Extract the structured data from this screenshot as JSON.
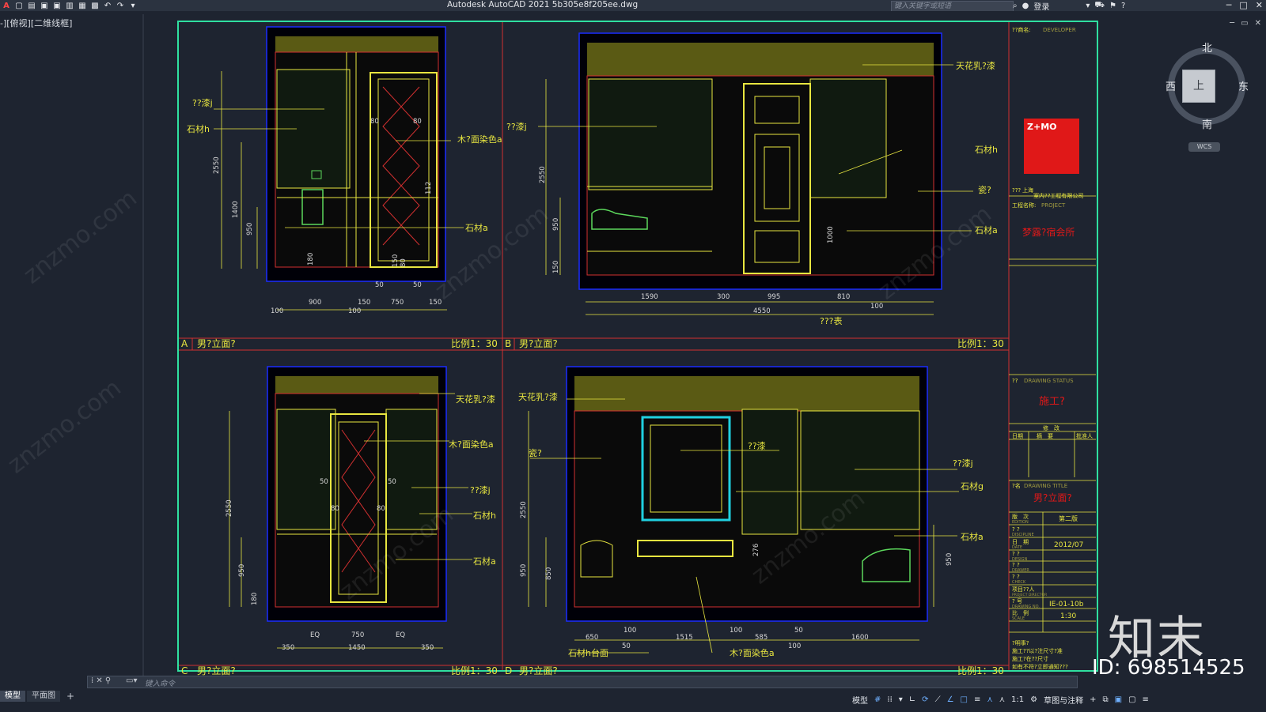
{
  "app": {
    "title": "Autodesk AutoCAD 2021    5b305e8f205ee.dwg",
    "search_placeholder": "键入关键字或短语",
    "login_label": "登录"
  },
  "viewport": {
    "label": "-][俯视][二维线框]"
  },
  "viewcube": {
    "north": "北",
    "south": "南",
    "east": "东",
    "west": "西",
    "face": "上",
    "wcs": "WCS"
  },
  "drawing": {
    "panels": {
      "a": {
        "letter": "A",
        "title": "男?立面?",
        "scale": "比例1：30"
      },
      "b": {
        "letter": "B",
        "title": "男?立面?",
        "scale": "比例1：30"
      },
      "c": {
        "letter": "C",
        "title": "男?立面?",
        "scale": "比例1：30"
      },
      "d": {
        "letter": "D",
        "title": "男?立面?",
        "scale": "比例1：30"
      }
    },
    "labels_a": [
      "??漆j",
      "石材h",
      "木?面染色a",
      "石材a"
    ],
    "dims_a": [
      "2550",
      "1400",
      "950",
      "180",
      "80",
      "80",
      "112",
      "150",
      "80",
      "50",
      "50",
      "100",
      "900",
      "100",
      "150",
      "750",
      "150"
    ],
    "labels_b": [
      "天花乳?漆",
      "??漆j",
      "石材h",
      "瓷?",
      "石材a",
      "???表"
    ],
    "dims_b": [
      "2550",
      "950",
      "150",
      "1000",
      "1590",
      "300",
      "995",
      "810",
      "100",
      "4550"
    ],
    "labels_c": [
      "天花乳?漆",
      "木?面染色a",
      "??漆j",
      "石材h",
      "石材a"
    ],
    "dims_c": [
      "2550",
      "950",
      "180",
      "50",
      "50",
      "80",
      "80",
      "EQ",
      "750",
      "EQ",
      "350",
      "1450",
      "350"
    ],
    "labels_d": [
      "天花乳?漆",
      "瓷?",
      "??漆",
      "??漆j",
      "石材g",
      "石材a",
      "石材h台面",
      "木?面染色a"
    ],
    "dims_d": [
      "2550",
      "950",
      "850",
      "276",
      "950",
      "650",
      "100",
      "50",
      "1515",
      "100",
      "585",
      "50",
      "1600",
      "100"
    ]
  },
  "title_block": {
    "designer_label": "??商名:",
    "designer_en": "DEVELOPER",
    "company_label": "???",
    "company_name": "上海",
    "company_name2": "室内??工程有限公司",
    "project_label": "工程名称:",
    "project_en": "PROJECT",
    "project_name": "梦露?宿会所",
    "status_label": "??",
    "status_en": "DRAWING STATUS",
    "status_value": "施工?",
    "revision_header": "修　改",
    "rev_cols": [
      "日期",
      "摘　要",
      "批准人"
    ],
    "title_label": "?名",
    "title_en": "DRAWING TITLE",
    "title_value": "男?立面?",
    "rows": [
      {
        "label": "版　次",
        "en": "EDITION",
        "value": "第二版"
      },
      {
        "label": "? ?",
        "en": "DISCIPLINE",
        "value": ""
      },
      {
        "label": "日　期",
        "en": "DATE",
        "value": "2012/07"
      },
      {
        "label": "? ?",
        "en": "DESIGN",
        "value": ""
      },
      {
        "label": "? ?",
        "en": "DRAWER",
        "value": ""
      },
      {
        "label": "? ?",
        "en": "CHECK",
        "value": ""
      },
      {
        "label": "项目??人",
        "en": "PROJECT DIRECTOR",
        "value": ""
      },
      {
        "label": "? 号",
        "en": "DRAWING NO.",
        "value": "IE-01-10b"
      },
      {
        "label": "比　例",
        "en": "SCALE",
        "value": "1:30"
      }
    ],
    "notes_label": "?明事?",
    "notes": [
      "施工??以?注尺寸?准",
      "施工?在??尺寸",
      "如有不符?立即通知???"
    ],
    "logo_text": "Z+MO"
  },
  "watermark": {
    "site": "znzmo.com",
    "brand": "知末",
    "id": "ID: 698514525"
  },
  "command": {
    "placeholder": "键入命令"
  },
  "tabs": [
    "模型",
    "平面图"
  ],
  "status": {
    "model": "模型",
    "scale": "1:1",
    "workspace": "草图与注释"
  },
  "colors": {
    "background": "#1e2430",
    "frame": "#2fe0a0",
    "panel_border": "#d23030",
    "yellow": "#e8e640",
    "green": "#5cd85c",
    "dim_white": "#d8d8d8",
    "logo_red": "#e01818"
  }
}
